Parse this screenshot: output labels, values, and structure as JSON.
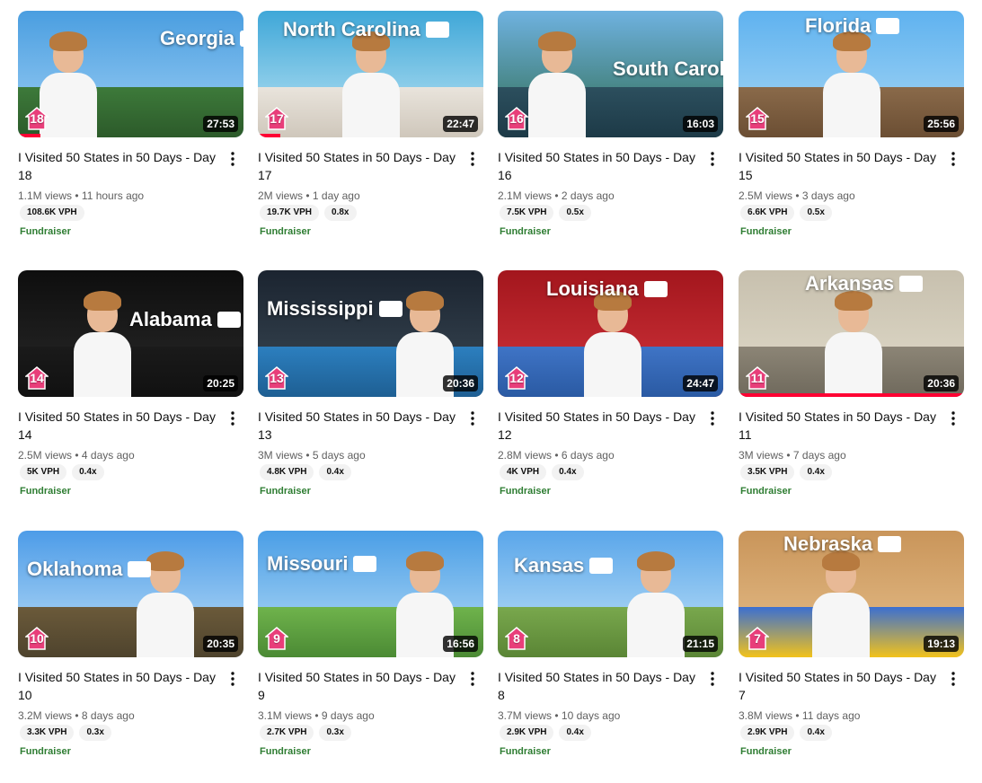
{
  "accent": "#ff0033",
  "fundraiser_color": "#2e7d32",
  "badge_color": "#e83e7a",
  "videos": [
    {
      "state": "Georgia",
      "day": "18",
      "duration": "27:53",
      "title": "I Visited 50 States in 50 Days - Day 18",
      "views": "1.1M views",
      "age": "11 hours ago",
      "vph": "108.6K VPH",
      "ratio": "",
      "fundraiser": "Fundraiser",
      "progress": 0.1
    },
    {
      "state": "North Carolina",
      "day": "17",
      "duration": "22:47",
      "title": "I Visited 50 States in 50 Days - Day 17",
      "views": "2M views",
      "age": "1 day ago",
      "vph": "19.7K VPH",
      "ratio": "0.8x",
      "fundraiser": "Fundraiser",
      "progress": 0.1
    },
    {
      "state": "South Carolina",
      "day": "16",
      "duration": "16:03",
      "title": "I Visited 50 States in 50 Days - Day 16",
      "views": "2.1M views",
      "age": "2 days ago",
      "vph": "7.5K VPH",
      "ratio": "0.5x",
      "fundraiser": "Fundraiser",
      "progress": 0
    },
    {
      "state": "Florida",
      "day": "15",
      "duration": "25:56",
      "title": "I Visited 50 States in 50 Days - Day 15",
      "views": "2.5M views",
      "age": "3 days ago",
      "vph": "6.6K VPH",
      "ratio": "0.5x",
      "fundraiser": "Fundraiser",
      "progress": 0
    },
    {
      "state": "Alabama",
      "day": "14",
      "duration": "20:25",
      "title": "I Visited 50 States in 50 Days - Day 14",
      "views": "2.5M views",
      "age": "4 days ago",
      "vph": "5K VPH",
      "ratio": "0.4x",
      "fundraiser": "Fundraiser",
      "progress": 0
    },
    {
      "state": "Mississippi",
      "day": "13",
      "duration": "20:36",
      "title": "I Visited 50 States in 50 Days - Day 13",
      "views": "3M views",
      "age": "5 days ago",
      "vph": "4.8K VPH",
      "ratio": "0.4x",
      "fundraiser": "Fundraiser",
      "progress": 0
    },
    {
      "state": "Louisiana",
      "day": "12",
      "duration": "24:47",
      "title": "I Visited 50 States in 50 Days - Day 12",
      "views": "2.8M views",
      "age": "6 days ago",
      "vph": "4K VPH",
      "ratio": "0.4x",
      "fundraiser": "Fundraiser",
      "progress": 0
    },
    {
      "state": "Arkansas",
      "day": "11",
      "duration": "20:36",
      "title": "I Visited 50 States in 50 Days - Day 11",
      "views": "3M views",
      "age": "7 days ago",
      "vph": "3.5K VPH",
      "ratio": "0.4x",
      "fundraiser": "Fundraiser",
      "progress": 1.0
    },
    {
      "state": "Oklahoma",
      "day": "10",
      "duration": "20:35",
      "title": "I Visited 50 States in 50 Days - Day 10",
      "views": "3.2M views",
      "age": "8 days ago",
      "vph": "3.3K VPH",
      "ratio": "0.3x",
      "fundraiser": "Fundraiser",
      "progress": 0
    },
    {
      "state": "Missouri",
      "day": "9",
      "duration": "16:56",
      "title": "I Visited 50 States in 50 Days - Day 9",
      "views": "3.1M views",
      "age": "9 days ago",
      "vph": "2.7K VPH",
      "ratio": "0.3x",
      "fundraiser": "Fundraiser",
      "progress": 0
    },
    {
      "state": "Kansas",
      "day": "8",
      "duration": "21:15",
      "title": "I Visited 50 States in 50 Days - Day 8",
      "views": "3.7M views",
      "age": "10 days ago",
      "vph": "2.9K VPH",
      "ratio": "0.4x",
      "fundraiser": "Fundraiser",
      "progress": 0
    },
    {
      "state": "Nebraska",
      "day": "7",
      "duration": "19:13",
      "title": "I Visited 50 States in 50 Days - Day 7",
      "views": "3.8M views",
      "age": "11 days ago",
      "vph": "2.9K VPH",
      "ratio": "0.4x",
      "fundraiser": "Fundraiser",
      "progress": 0
    }
  ]
}
